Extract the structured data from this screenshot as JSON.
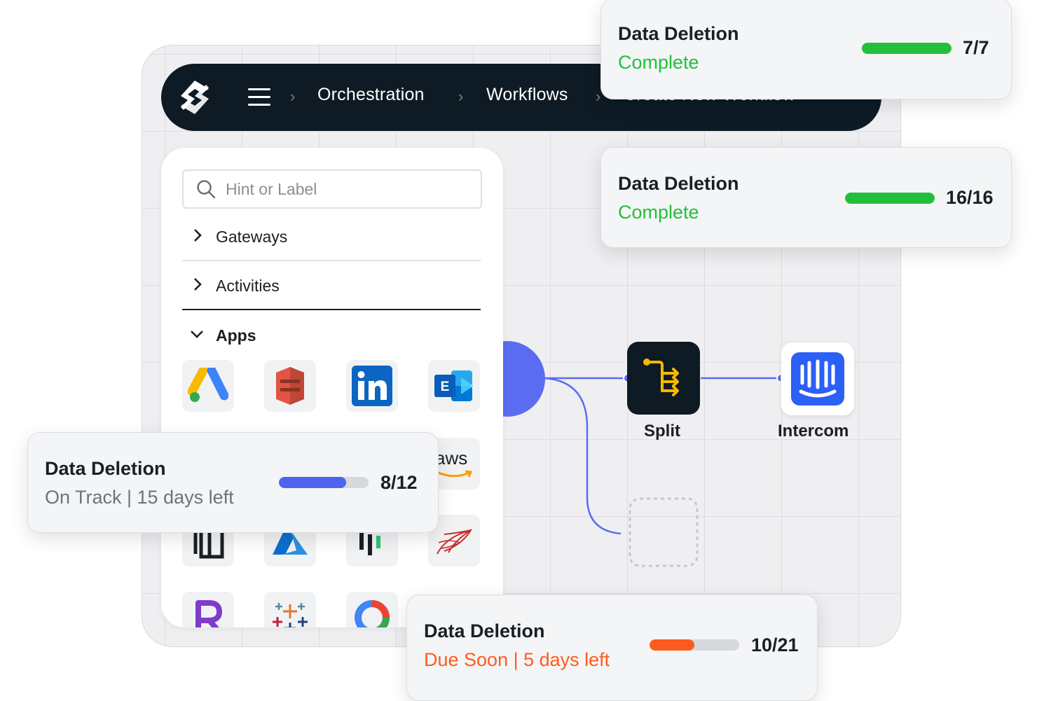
{
  "nav": {
    "breadcrumbs": [
      "Orchestration",
      "Workflows",
      "Create New Workflow"
    ],
    "logo_icon": "brand-logo-icon",
    "menu_icon": "hamburger-menu-icon"
  },
  "panel": {
    "search": {
      "placeholder": "Hint or Label"
    },
    "sections": [
      {
        "label": "Gateways",
        "expanded": false
      },
      {
        "label": "Activities",
        "expanded": false
      },
      {
        "label": "Apps",
        "expanded": true
      }
    ],
    "apps": [
      "google-ads-icon",
      "amazon-s3-icon",
      "linkedin-icon",
      "exchange-icon",
      "aws-icon",
      "box-icon",
      "azure-icon",
      "pendo-icon",
      "sql-server-icon",
      "r-icon",
      "tableau-icon",
      "looker-icon"
    ],
    "aws_label": "aws"
  },
  "workflow": {
    "nodes": [
      {
        "label": "Split",
        "icon": "split-icon"
      },
      {
        "label": "Intercom",
        "icon": "intercom-icon"
      }
    ]
  },
  "cards": [
    {
      "title": "Data Deletion",
      "status": "Complete",
      "count": "7/7",
      "progress": 1.0,
      "color": "#22c03a"
    },
    {
      "title": "Data Deletion",
      "status": "Complete",
      "count": "16/16",
      "progress": 1.0,
      "color": "#22c03a"
    },
    {
      "title": "Data Deletion",
      "status": "On Track | 15 days left",
      "count": "8/12",
      "progress": 0.75,
      "color": "#4f63ee"
    },
    {
      "title": "Data Deletion",
      "status": "Due Soon | 5 days left",
      "count": "10/21",
      "progress": 0.5,
      "color": "#ff5a1f"
    }
  ],
  "colors": {
    "nav_bg": "#0e1b24",
    "accent": "#5b6cf2",
    "complete": "#22c03a",
    "on_track_text": "#6d737a",
    "due_soon": "#ff5a1f"
  }
}
